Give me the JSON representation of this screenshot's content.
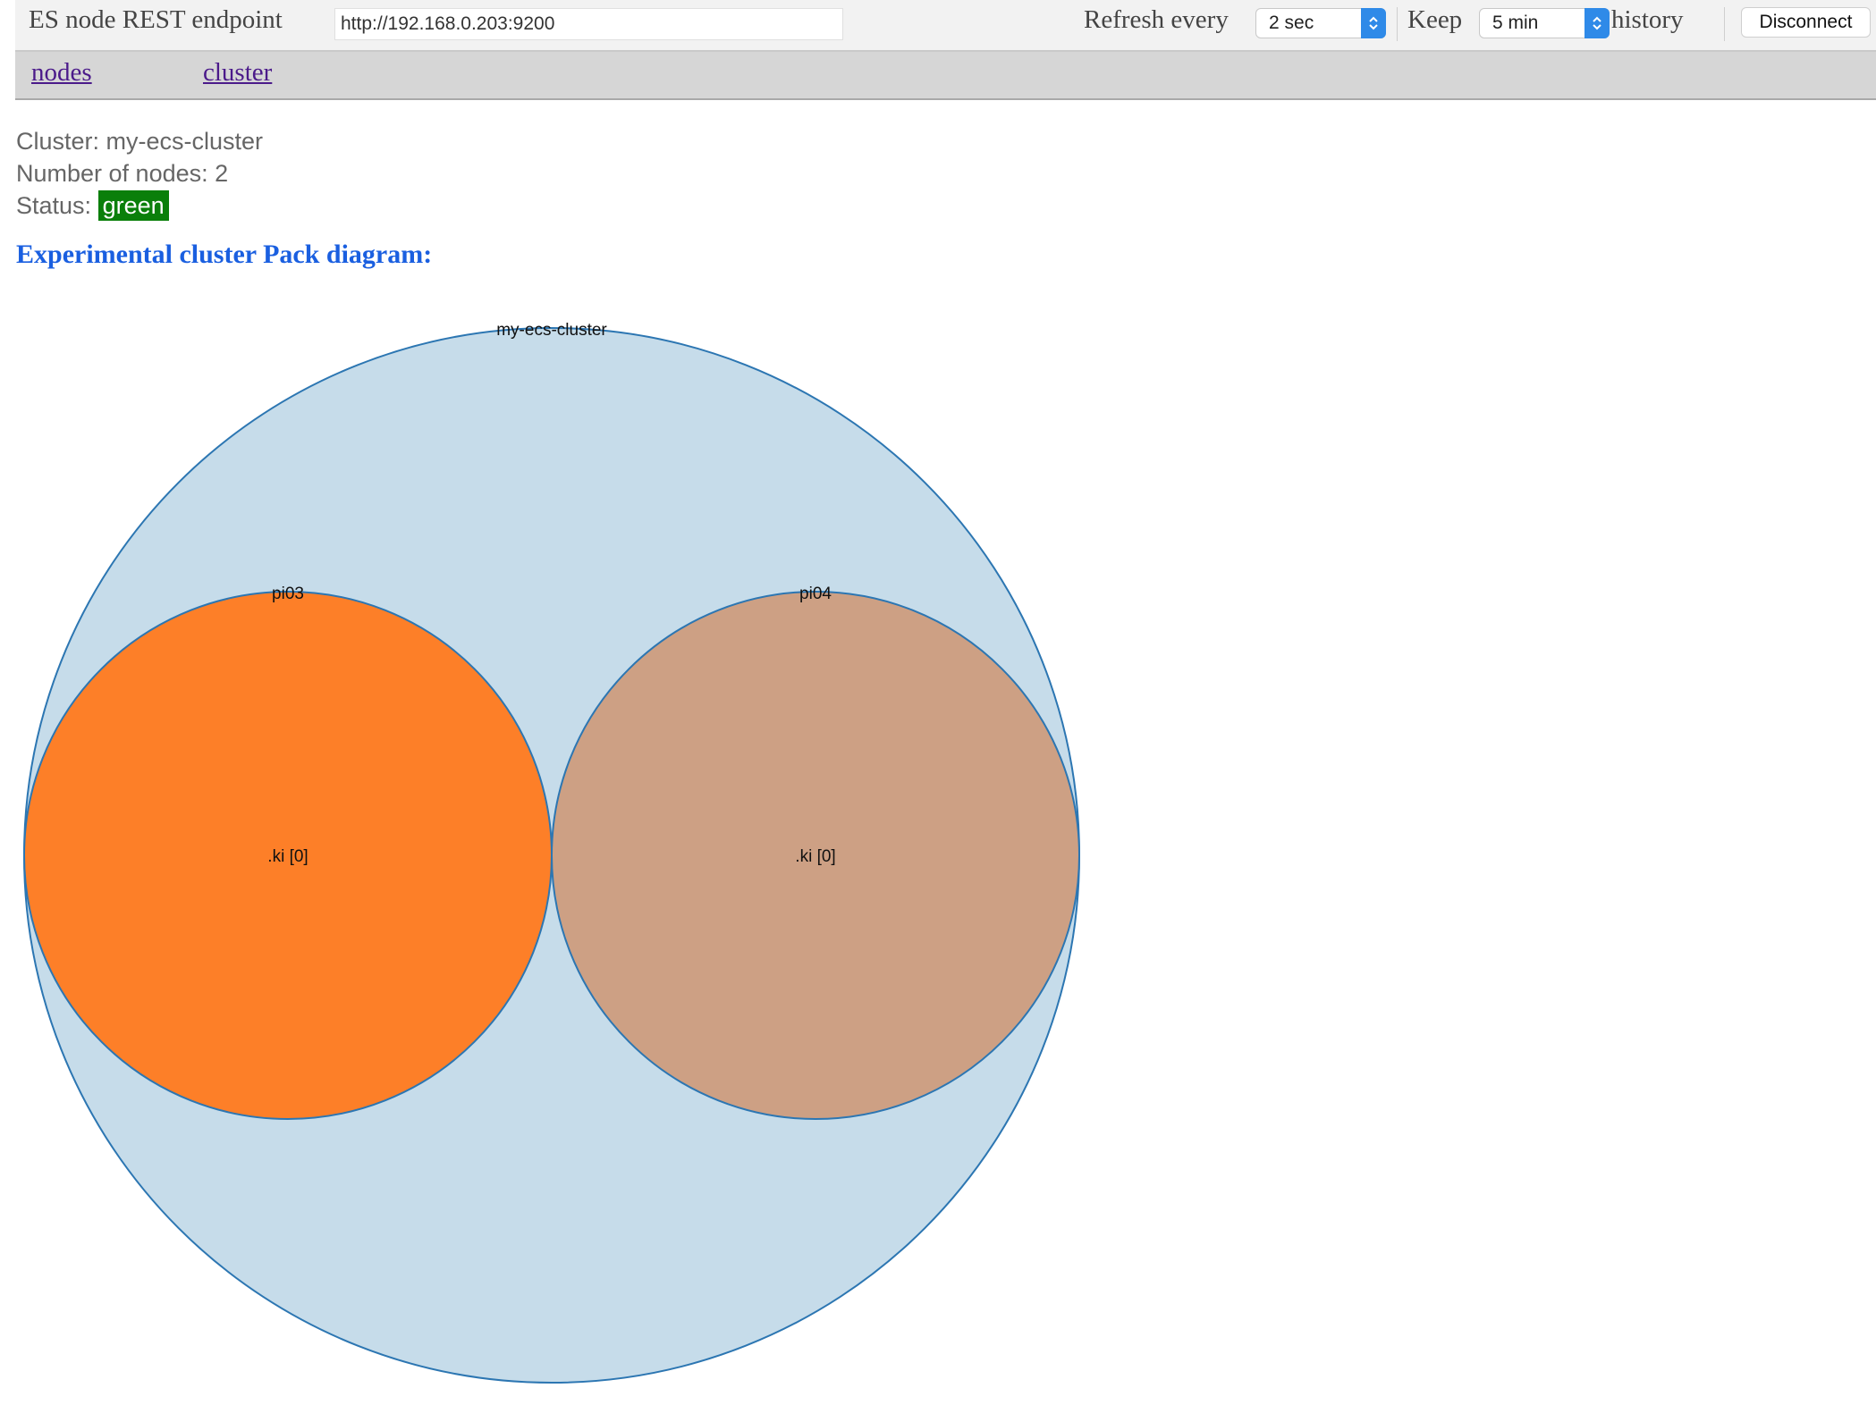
{
  "toolbar": {
    "endpoint_label": "ES node REST endpoint",
    "endpoint_value": "http://192.168.0.203:9200",
    "refresh_label": "Refresh every",
    "refresh_value": "2 sec",
    "keep_label": "Keep",
    "keep_value": "5 min",
    "history_label": "history",
    "disconnect_label": "Disconnect"
  },
  "nav": {
    "nodes": "nodes",
    "cluster": "cluster"
  },
  "info": {
    "cluster_line": "Cluster: my-ecs-cluster",
    "nodes_line": "Number of nodes: 2",
    "status_label": "Status:",
    "status_value": "green"
  },
  "diagram": {
    "heading": "Experimental cluster Pack diagram:",
    "cluster_name": "my-ecs-cluster",
    "nodes": [
      {
        "name": "pi03",
        "shard_label": ".ki [0]",
        "color": "#fd7f28"
      },
      {
        "name": "pi04",
        "shard_label": ".ki [0]",
        "color": "#cda084"
      }
    ]
  },
  "colors": {
    "cluster_fill": "#c6dcea",
    "circle_stroke": "#2c76b2",
    "status_green": "#0a7f0a",
    "link": "#4b1a8a",
    "heading": "#1a5fe0"
  }
}
